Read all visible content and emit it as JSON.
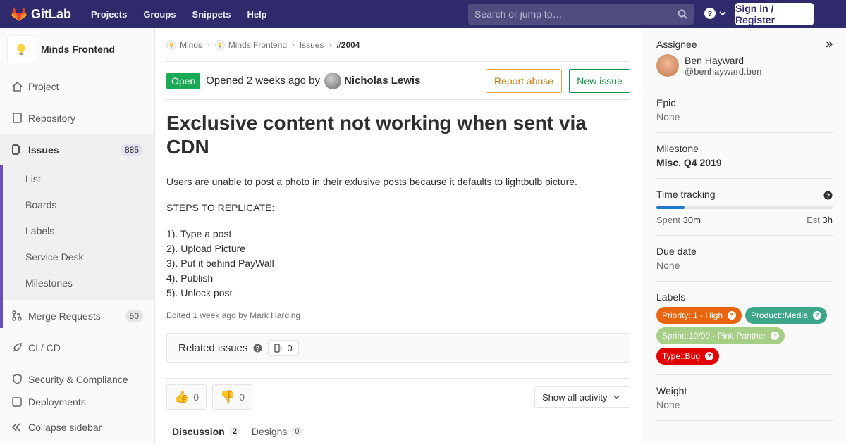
{
  "topbar": {
    "brand": "GitLab",
    "nav": [
      "Projects",
      "Groups",
      "Snippets",
      "Help"
    ],
    "search_placeholder": "Search or jump to…",
    "signin": "Sign in / Register"
  },
  "sidebar": {
    "project_name": "Minds Frontend",
    "items": [
      {
        "label": "Project"
      },
      {
        "label": "Repository"
      },
      {
        "label": "Issues",
        "badge": "885"
      },
      {
        "label": "Merge Requests",
        "badge": "50"
      },
      {
        "label": "CI / CD"
      },
      {
        "label": "Security & Compliance"
      },
      {
        "label": "Deployments"
      }
    ],
    "issue_sub": [
      "List",
      "Boards",
      "Labels",
      "Service Desk",
      "Milestones"
    ],
    "collapse": "Collapse sidebar"
  },
  "breadcrumb": [
    "Minds",
    "Minds Frontend",
    "Issues",
    "#2004"
  ],
  "issue": {
    "status": "Open",
    "opened": "Opened 2 weeks ago by",
    "author": "Nicholas Lewis",
    "report_abuse": "Report abuse",
    "new_issue": "New issue",
    "title": "Exclusive content not working when sent via CDN",
    "description": "Users are unable to post a photo in their exlusive posts because it defaults to lightbulb picture.",
    "steps_heading": "STEPS TO REPLICATE:",
    "steps": [
      "1). Type a post",
      "2). Upload Picture",
      "3). Put it behind PayWall",
      "4). Publish",
      "5). Unlock post"
    ],
    "edited": "Edited 1 week ago by Mark Harding",
    "related_label": "Related issues",
    "related_count": "0",
    "thumbs_up": "0",
    "thumbs_down": "0",
    "activity_filter": "Show all activity",
    "tabs": [
      {
        "label": "Discussion",
        "count": "2"
      },
      {
        "label": "Designs",
        "count": "0"
      }
    ]
  },
  "right_sidebar": {
    "assignee_title": "Assignee",
    "assignee_name": "Ben Hayward",
    "assignee_user": "@benhayward.ben",
    "epic_title": "Epic",
    "epic_value": "None",
    "milestone_title": "Milestone",
    "milestone_value": "Misc. Q4 2019",
    "time_title": "Time tracking",
    "spent_label": "Spent",
    "spent_value": "30m",
    "est_label": "Est",
    "est_value": "3h",
    "time_progress": 0.16,
    "due_title": "Due date",
    "due_value": "None",
    "labels_title": "Labels",
    "labels": [
      {
        "text": "Priority::1 - High",
        "color": "#e8650e"
      },
      {
        "text": "Product::Media",
        "color": "#3da58a"
      },
      {
        "text": "Sprint::10/09 - Pink Panther",
        "color": "#a6cf86"
      },
      {
        "text": "Type::Bug",
        "color": "#e30000"
      }
    ],
    "weight_title": "Weight",
    "weight_value": "None"
  },
  "colors": {
    "topbar": "#2f2a6b",
    "accent": "#6b4fbb",
    "open": "#1aaa55"
  }
}
